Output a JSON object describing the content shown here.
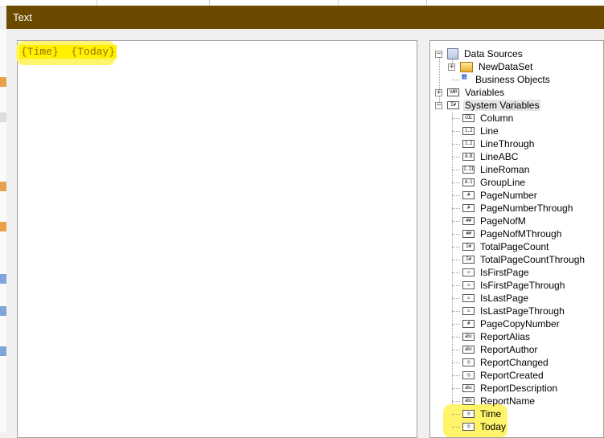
{
  "window": {
    "title": "Text"
  },
  "editor": {
    "text": "{Time}  {Today}"
  },
  "tree": {
    "data_sources": "Data Sources",
    "new_data_set": "NewDataSet",
    "business_objects": "Business Objects",
    "variables": "Variables",
    "system_variables": "System Variables",
    "items": [
      {
        "label": "Column",
        "icon": "COL"
      },
      {
        "label": "Line",
        "icon": "1.2"
      },
      {
        "label": "LineThrough",
        "icon": "1.2"
      },
      {
        "label": "LineABC",
        "icon": "A.B"
      },
      {
        "label": "LineRoman",
        "icon": "I.II"
      },
      {
        "label": "GroupLine",
        "icon": "A.1"
      },
      {
        "label": "PageNumber",
        "icon": "#"
      },
      {
        "label": "PageNumberThrough",
        "icon": "#"
      },
      {
        "label": "PageNofM",
        "icon": "##"
      },
      {
        "label": "PageNofMThrough",
        "icon": "##"
      },
      {
        "label": "TotalPageCount",
        "icon": "Σ#"
      },
      {
        "label": "TotalPageCountThrough",
        "icon": "Σ#"
      },
      {
        "label": "IsFirstPage",
        "icon": "☑"
      },
      {
        "label": "IsFirstPageThrough",
        "icon": "☑"
      },
      {
        "label": "IsLastPage",
        "icon": "☑"
      },
      {
        "label": "IsLastPageThrough",
        "icon": "☑"
      },
      {
        "label": "PageCopyNumber",
        "icon": "#"
      },
      {
        "label": "ReportAlias",
        "icon": "abc"
      },
      {
        "label": "ReportAuthor",
        "icon": "abc"
      },
      {
        "label": "ReportChanged",
        "icon": "◷"
      },
      {
        "label": "ReportCreated",
        "icon": "◷"
      },
      {
        "label": "ReportDescription",
        "icon": "abc"
      },
      {
        "label": "ReportName",
        "icon": "abc"
      },
      {
        "label": "Time",
        "icon": "◷"
      },
      {
        "label": "Today",
        "icon": "◷"
      }
    ]
  },
  "icons": {
    "data_sources": "database-icon",
    "new_data_set": "dataset-icon",
    "business_objects": "business-objects-icon",
    "variables": "VAR",
    "system_variables": "Σ#"
  },
  "colors": {
    "titlebar": "#6b4a00",
    "highlight": "#fff200",
    "field_text": "#9c6a00"
  }
}
